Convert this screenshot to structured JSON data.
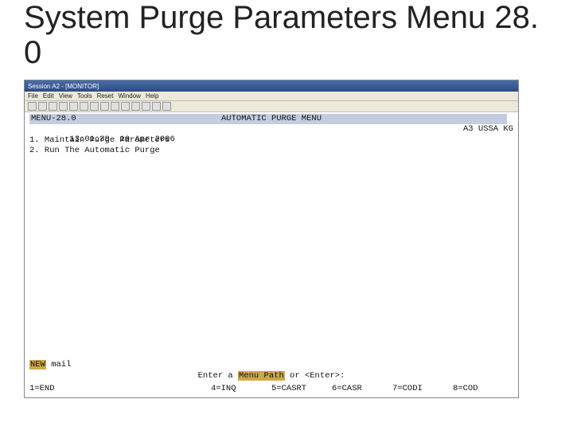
{
  "slide": {
    "title": "System Purge Parameters Menu 28. 0"
  },
  "window": {
    "title": "Session A2 - [MONITOR]",
    "menubar": [
      "File",
      "Edit",
      "View",
      "Tools",
      "Reset",
      "Window",
      "Help"
    ]
  },
  "term": {
    "header": {
      "menu_id": "MENU-28.0",
      "title": "AUTOMATIC PURGE MENU"
    },
    "status": {
      "time": "13:01:38",
      "date": "10 Apr 2006",
      "site": "A3 USSA KG"
    },
    "items": [
      "1. Maintain Purge Parameters",
      "2. Run The Automatic Purge"
    ],
    "mail": {
      "badge": "NEW",
      "text": " mail"
    },
    "prompt": {
      "pre": "Enter a ",
      "hl": "Menu Path",
      "post": " or <Enter>:"
    },
    "fkeys": {
      "k1": "1=END",
      "k4": "4=INQ",
      "k5": "5=CASRT",
      "k6": "6=CASR",
      "k7": "7=CODI",
      "k8": "8=COD"
    }
  }
}
